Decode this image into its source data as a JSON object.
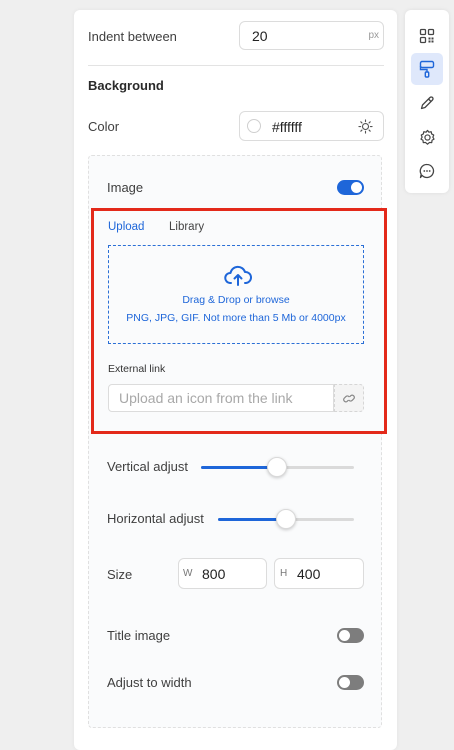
{
  "indent": {
    "label": "Indent between",
    "value": "20",
    "unit": "px"
  },
  "background": {
    "heading": "Background",
    "color_label": "Color",
    "color_value": "#ffffff",
    "swatch": "#ffffff"
  },
  "image": {
    "label": "Image",
    "enabled": true,
    "tabs": [
      "Upload",
      "Library"
    ],
    "active_tab": "Upload",
    "dropzone": {
      "line1": "Drag & Drop or browse",
      "line2": "PNG, JPG, GIF. Not more than 5 Mb or 4000px"
    },
    "external_link": {
      "label": "External link",
      "placeholder": "Upload an icon from the link"
    }
  },
  "vertical_adjust": {
    "label": "Vertical adjust",
    "value": 0.5
  },
  "horizontal_adjust": {
    "label": "Horizontal adjust",
    "value": 0.5
  },
  "size": {
    "label": "Size",
    "w_prefix": "W",
    "w_value": "800",
    "h_prefix": "H",
    "h_value": "400"
  },
  "title_image": {
    "label": "Title image",
    "enabled": false
  },
  "adjust_width": {
    "label": "Adjust to width",
    "enabled": false
  },
  "toolbar": {
    "items": [
      "qr-code-icon",
      "paint-roller-icon",
      "pen-icon",
      "gear-icon",
      "chat-icon"
    ],
    "active": "paint-roller-icon"
  },
  "colors": {
    "accent": "#1e66d9",
    "highlight": "#e3291a",
    "toggle_off": "#7d7d7d"
  }
}
